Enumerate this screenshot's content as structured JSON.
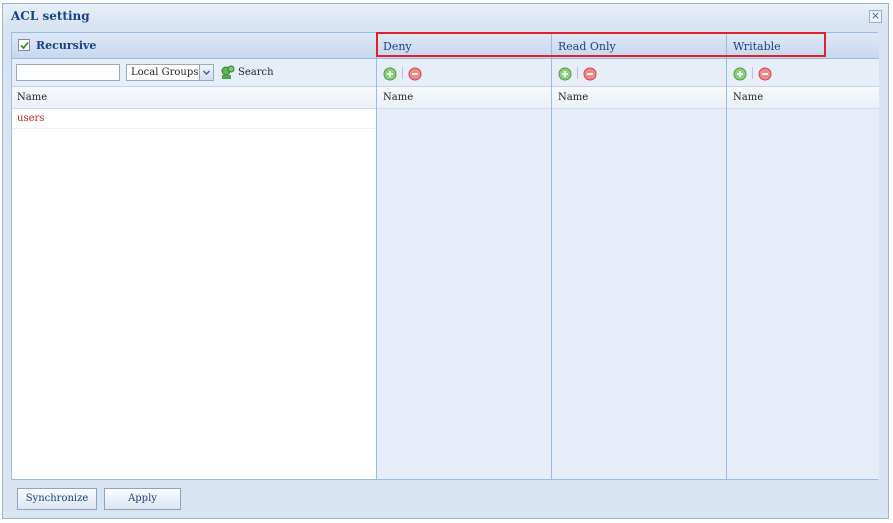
{
  "window": {
    "title": "ACL setting",
    "close_glyph": "×"
  },
  "left": {
    "recursive_label": "Recursive",
    "recursive_checked": true,
    "search_value": "",
    "group_select": "Local Groups",
    "search_label": "Search",
    "column_header": "Name",
    "rows": [
      "users"
    ]
  },
  "permissions": [
    {
      "title": "Deny",
      "column_header": "Name"
    },
    {
      "title": "Read Only",
      "column_header": "Name"
    },
    {
      "title": "Writable",
      "column_header": "Name"
    }
  ],
  "footer": {
    "synchronize_label": "Synchronize",
    "apply_label": "Apply"
  },
  "colors": {
    "accent": "#15428b",
    "highlight": "#e0202a",
    "row_text": "#d32020"
  },
  "icons": [
    "close-icon",
    "checkbox-icon",
    "dropdown-arrow-icon",
    "search-icon",
    "add-icon",
    "remove-icon"
  ]
}
